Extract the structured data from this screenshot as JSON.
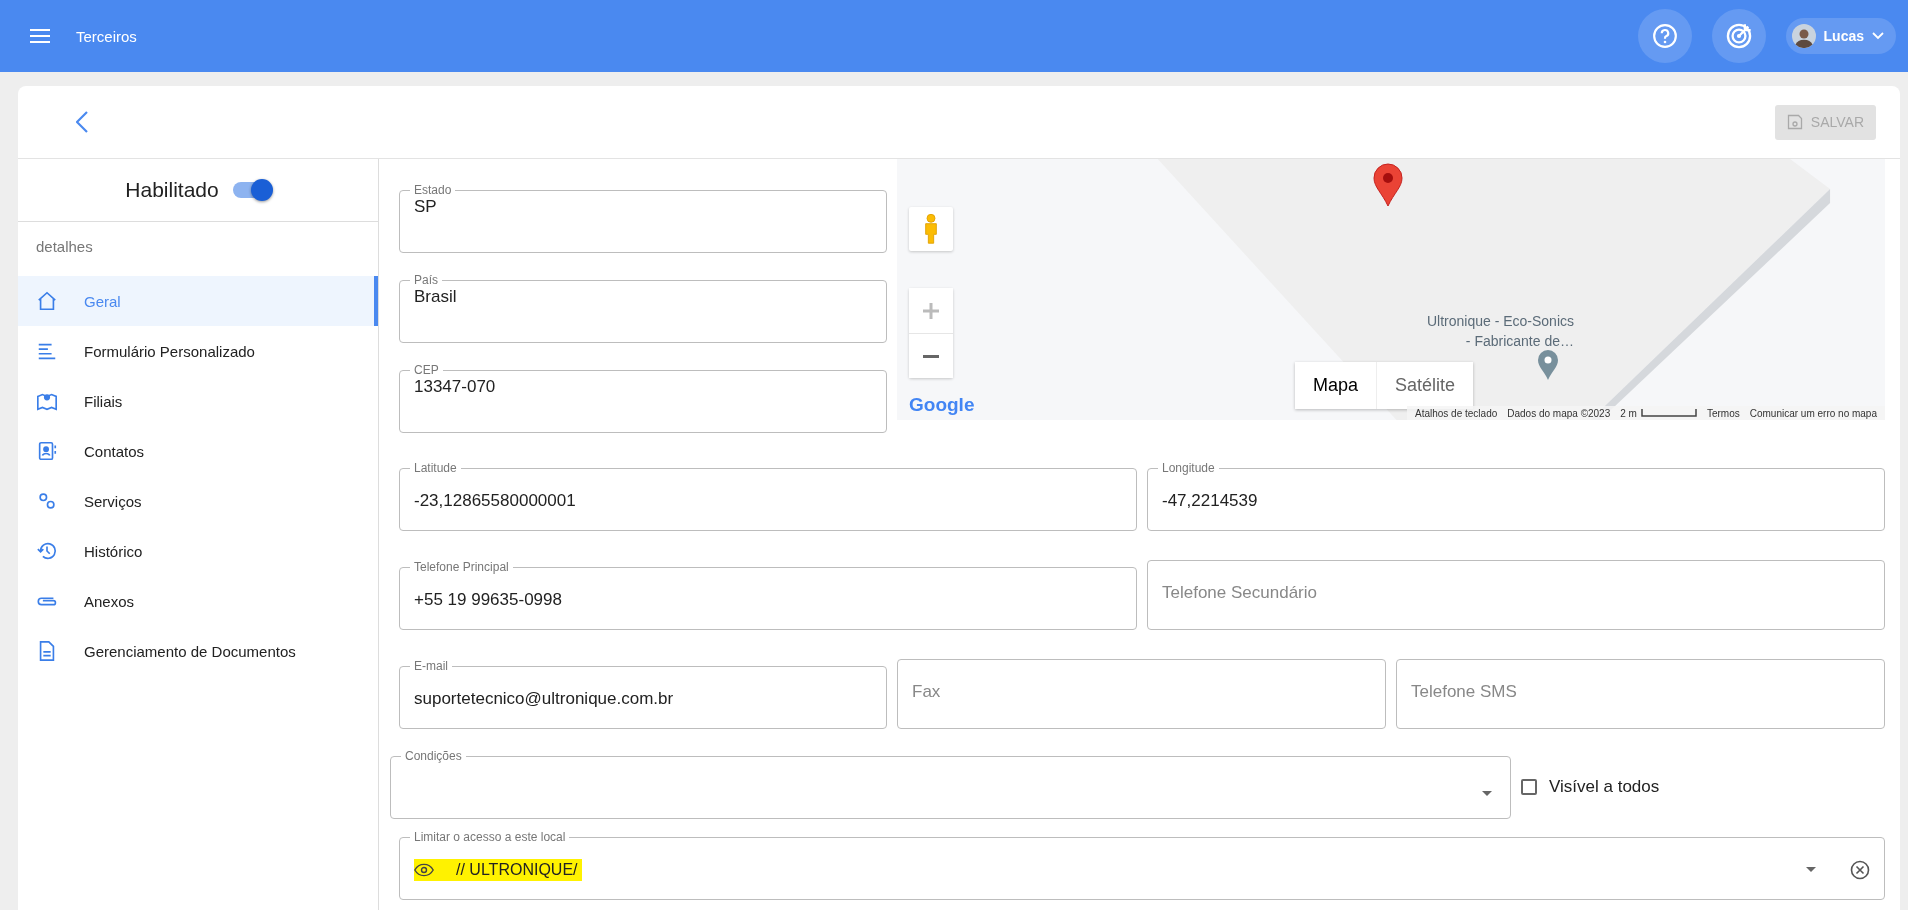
{
  "app_bar": {
    "title": "Terceiros",
    "user": {
      "name": "Lucas"
    }
  },
  "toolbar": {
    "save_button": {
      "label": "SALVAR",
      "disabled": true
    }
  },
  "status_toggle": {
    "label": "Habilitado",
    "on": true
  },
  "sidebar": {
    "section": "detalhes",
    "items": [
      {
        "label": "Geral",
        "selected": true
      },
      {
        "label": "Formulário Personalizado",
        "selected": false
      },
      {
        "label": "Filiais",
        "selected": false
      },
      {
        "label": "Contatos",
        "selected": false
      },
      {
        "label": "Serviços",
        "selected": false
      },
      {
        "label": "Histórico",
        "selected": false
      },
      {
        "label": "Anexos",
        "selected": false
      },
      {
        "label": "Gerenciamento de Documentos",
        "selected": false
      }
    ]
  },
  "address_fields": [
    {
      "label": "Estado",
      "value": "SP"
    },
    {
      "label": "País",
      "value": "Brasil"
    },
    {
      "label": "CEP",
      "value": "13347-070"
    }
  ],
  "map": {
    "place_label": [
      "Ultronique - Eco-Sonics",
      "- Fabricante de…"
    ],
    "map_types": [
      {
        "label": "Mapa",
        "selected": true
      },
      {
        "label": "Satélite",
        "selected": false
      }
    ],
    "logo": "Google",
    "attribution": [
      "Atalhos de teclado",
      "Dados do mapa ©2023",
      "2 m",
      "Termos",
      "Comunicar um erro no mapa"
    ]
  },
  "field_rows": [
    [
      {
        "label": "Latitude",
        "value": "-23,12865580000001"
      },
      {
        "label": "Longitude",
        "value": "-47,2214539"
      }
    ],
    [
      {
        "label": "Telefone Principal",
        "value": "+55 19 99635-0998"
      },
      {
        "placeholder": "Telefone Secundário"
      }
    ],
    [
      {
        "label": "E-mail",
        "value": "suportetecnico@ultronique.com.br"
      },
      {
        "placeholder": "Fax"
      },
      {
        "placeholder": "Telefone SMS"
      }
    ]
  ],
  "conditions": {
    "label": "Condições"
  },
  "visible_to_all": {
    "label": "Visível a todos",
    "checked": false
  },
  "access_limit": {
    "label": "Limitar o acesso a este local",
    "value": "// ULTRONIQUE/",
    "highlighted": true
  }
}
